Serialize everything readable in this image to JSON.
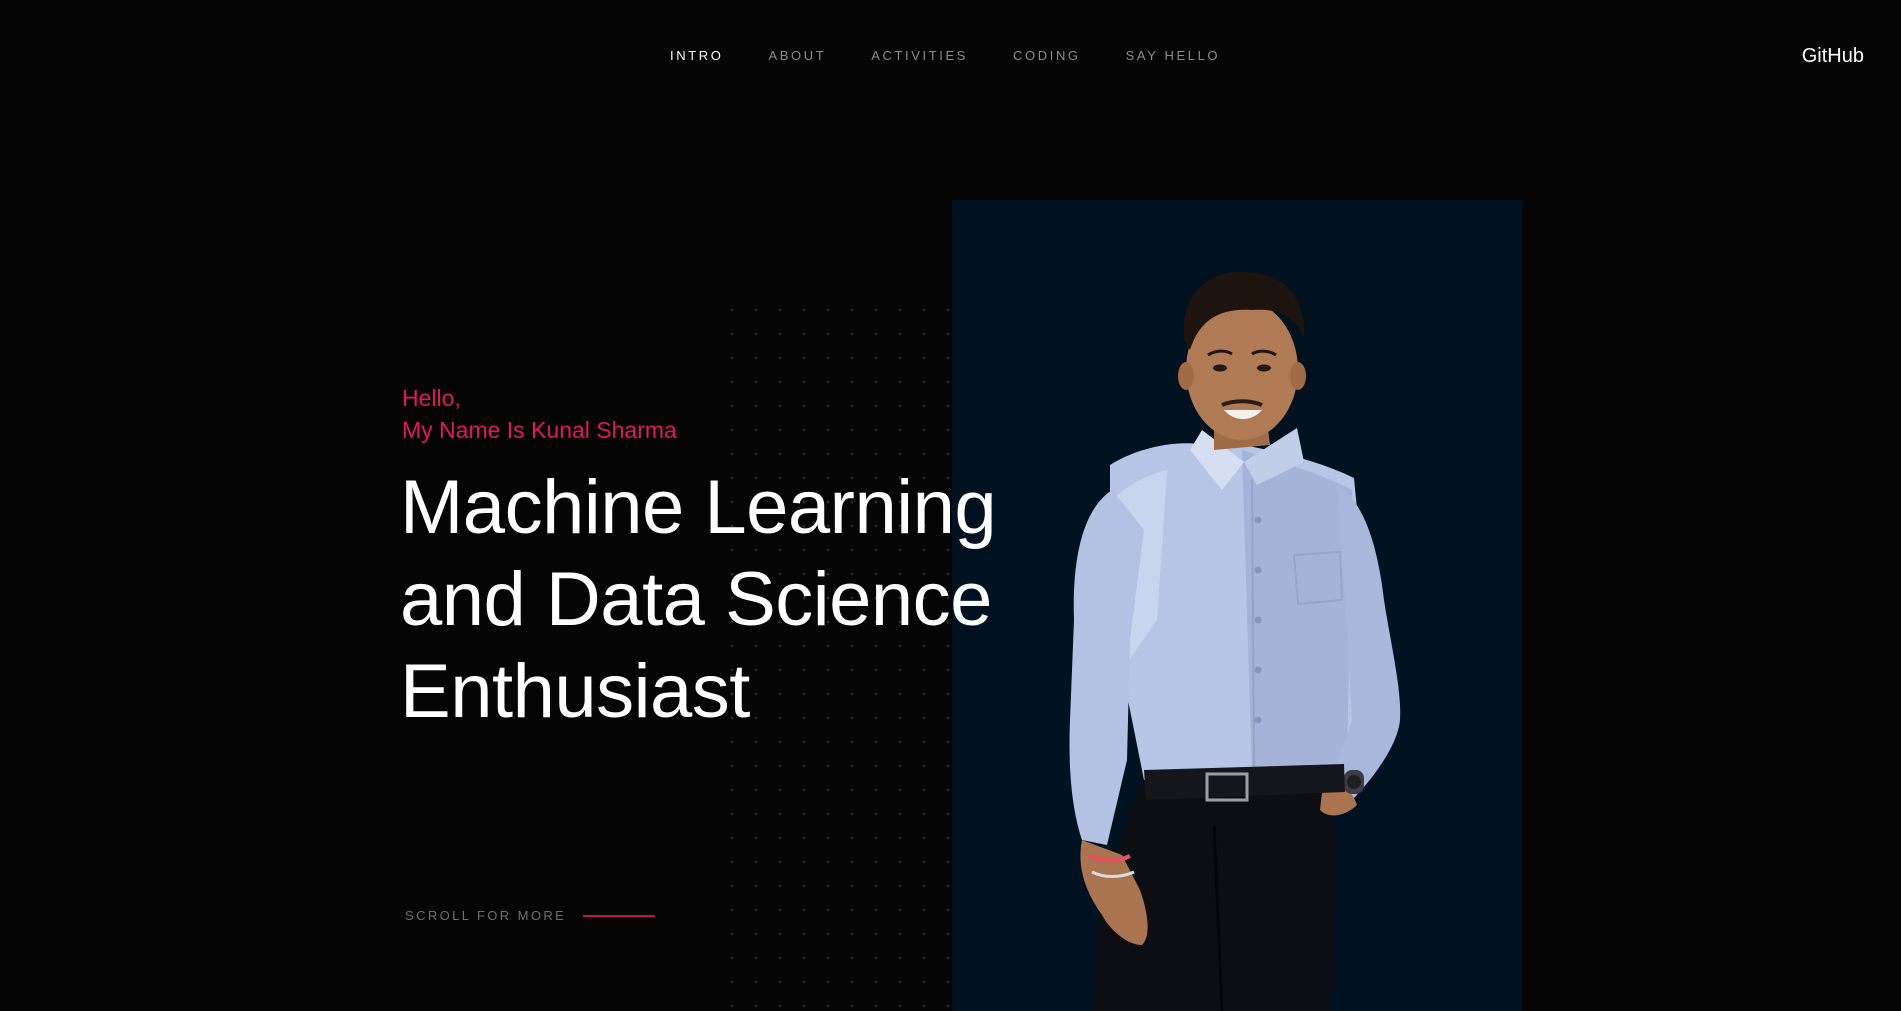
{
  "nav": {
    "links": [
      {
        "label": "INTRO",
        "active": true
      },
      {
        "label": "ABOUT",
        "active": false
      },
      {
        "label": "ACTIVITIES",
        "active": false
      },
      {
        "label": "CODING",
        "active": false
      },
      {
        "label": "SAY HELLO",
        "active": false
      }
    ],
    "github_label": "GitHub"
  },
  "hero": {
    "greeting_line1": "Hello,",
    "greeting_line2": "My Name Is Kunal Sharma",
    "headline_line1": "Machine Learning",
    "headline_line2": "and Data Science",
    "headline_line3": "Enthusiast"
  },
  "scroll": {
    "label": "SCROLL FOR MORE"
  },
  "colors": {
    "background": "#050505",
    "accent": "#e0185f",
    "photo_panel": "#001120",
    "nav_inactive": "#8c8c8c"
  }
}
